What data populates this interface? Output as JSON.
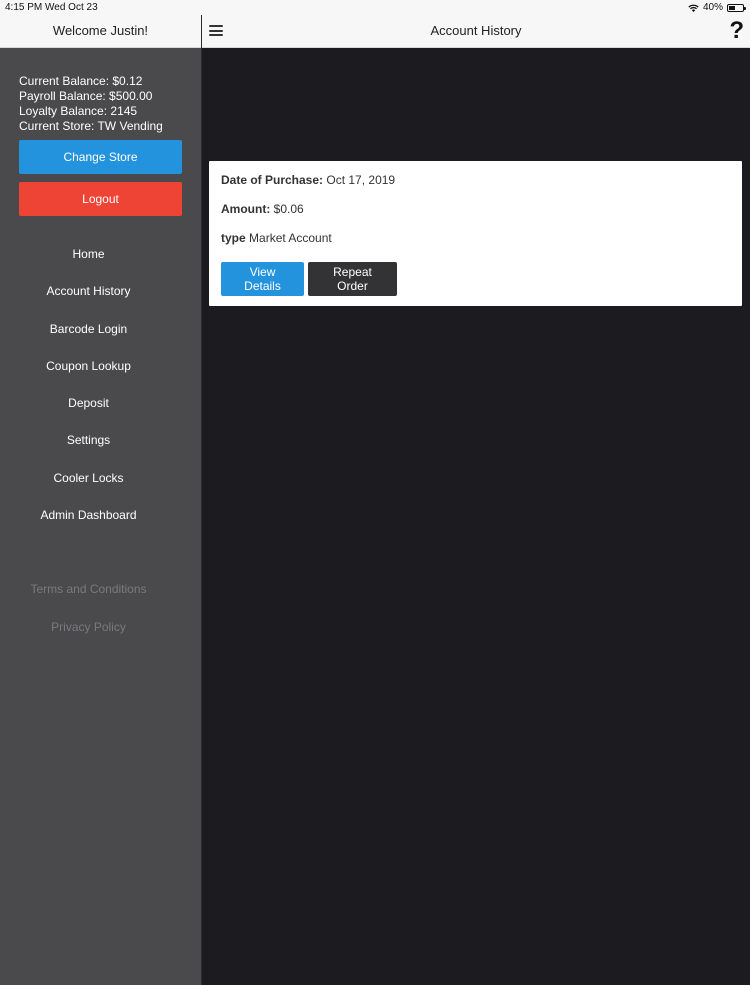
{
  "status_bar": {
    "time_date": "4:15 PM   Wed Oct 23",
    "battery": "40%",
    "icons": [
      "wifi-icon",
      "battery-icon"
    ]
  },
  "sidebar": {
    "welcome": "Welcome Justin!",
    "balances": {
      "current": "Current Balance: $0.12",
      "payroll": "Payroll Balance: $500.00",
      "loyalty": "Loyalty Balance: 2145",
      "store": "Current Store: TW Vending"
    },
    "change_store": "Change Store",
    "logout": "Logout",
    "nav": [
      "Home",
      "Account History",
      "Barcode Login",
      "Coupon Lookup",
      "Deposit",
      "Settings",
      "Cooler Locks",
      "Admin Dashboard"
    ],
    "footer": [
      "Terms and Conditions",
      "Privacy Policy"
    ]
  },
  "header": {
    "title": "Account History",
    "menu_icon": "hamburger-menu-icon",
    "help_icon": "?"
  },
  "purchase": {
    "date_label": "Date of Purchase:",
    "date_value": "Oct 17, 2019",
    "amount_label": "Amount:",
    "amount_value": "$0.06",
    "type_label": "type",
    "type_value": "Market Account",
    "view_details": "View Details",
    "repeat_order": "Repeat Order"
  },
  "colors": {
    "primary": "#2493dd",
    "danger": "#ee4436",
    "dark_button": "#333235",
    "sidebar_bg": "#4a494c",
    "content_bg": "#1c1b1f"
  }
}
